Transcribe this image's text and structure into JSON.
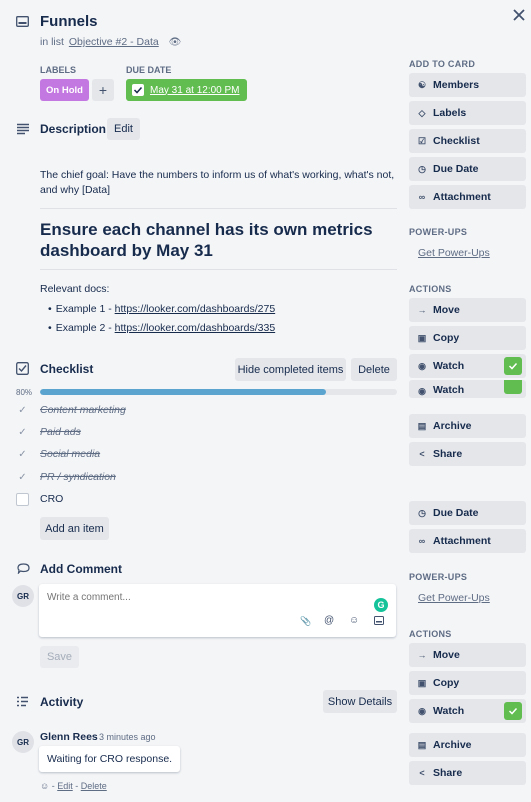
{
  "card": {
    "title": "Funnels",
    "list_prefix": "in list",
    "list_name": "Objective #2 - Data"
  },
  "labels": {
    "header": "LABELS",
    "items": [
      "On Hold"
    ],
    "add": "+",
    "color": "#c377e0"
  },
  "due": {
    "header": "DUE DATE",
    "value": "May 31 at 12:00 PM",
    "color": "#61bd4f"
  },
  "description": {
    "title": "Description",
    "edit_label": "Edit",
    "paragraph": "The chief goal: Have the numbers to inform us of what's working, what's not, and why [Data]",
    "heading": "Ensure each channel has its own metrics dashboard by May 31",
    "docs_label": "Relevant docs:",
    "docs": [
      {
        "prefix": "Example 1 - ",
        "url": "https://looker.com/dashboards/275"
      },
      {
        "prefix": "Example 2 - ",
        "url": "https://looker.com/dashboards/335"
      }
    ]
  },
  "checklist": {
    "title": "Checklist",
    "hide_label": "Hide completed items",
    "delete_label": "Delete",
    "progress_text": "80%",
    "progress": 0.8,
    "items": [
      {
        "text": "Content marketing",
        "done": true
      },
      {
        "text": "Paid ads",
        "done": true
      },
      {
        "text": "Social media",
        "done": true
      },
      {
        "text": "PR / syndication",
        "done": true
      },
      {
        "text": "CRO",
        "done": false
      }
    ],
    "add_label": "Add an item"
  },
  "comment": {
    "title": "Add Comment",
    "avatar": "GR",
    "placeholder": "Write a comment...",
    "save_label": "Save"
  },
  "activity": {
    "title": "Activity",
    "show_label": "Show Details",
    "entries": [
      {
        "avatar": "GR",
        "author": "Glenn Rees",
        "time": "3 minutes ago",
        "text": "Waiting for CRO response.",
        "edit": "Edit",
        "delete": "Delete"
      }
    ]
  },
  "sidebar": {
    "add_to_card": "ADD TO CARD",
    "add_items": [
      "Members",
      "Labels",
      "Checklist",
      "Due Date",
      "Attachment"
    ],
    "powerups": "POWER-UPS",
    "get_powerups": "Get Power-Ups",
    "actions": "ACTIONS",
    "action_items": [
      "Move",
      "Copy",
      "Watch",
      "Archive",
      "Share"
    ],
    "ghost_watch": "Watch",
    "dup_items": [
      "Due Date",
      "Attachment"
    ],
    "dup_powerups": "POWER-UPS",
    "dup_get_powerups": "Get Power-Ups",
    "dup_actions": "ACTIONS",
    "dup_action_items": [
      "Move",
      "Copy",
      "Watch",
      "Archive",
      "Share"
    ]
  },
  "colors": {
    "accent": "#5ba4cf",
    "green": "#61bd4f",
    "purple": "#c377e0"
  }
}
